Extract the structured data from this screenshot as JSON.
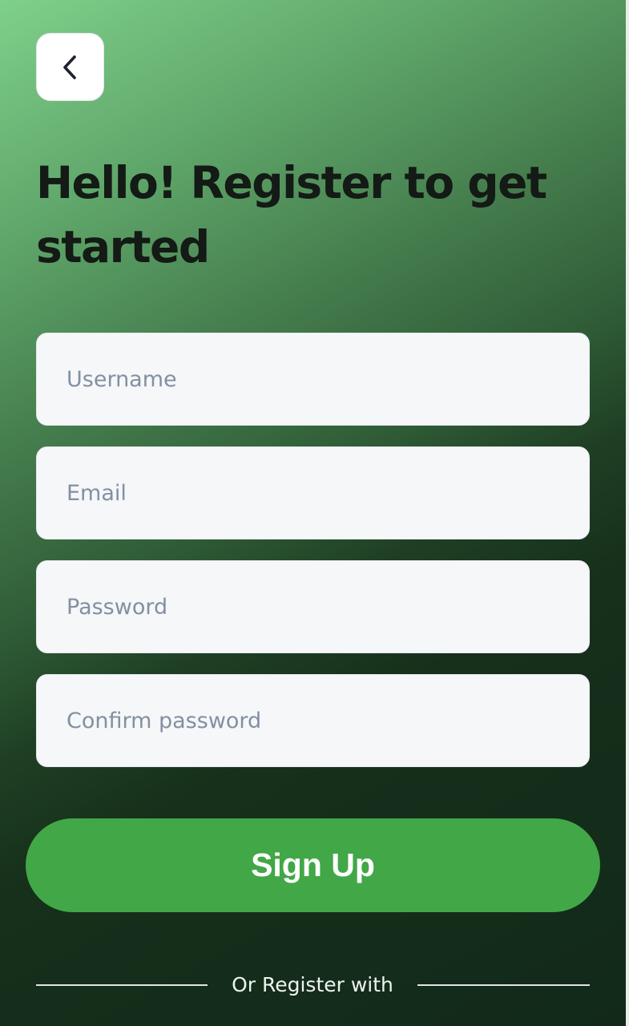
{
  "header": {
    "back_icon": "chevron-left-icon"
  },
  "title": "Hello! Register to get started",
  "form": {
    "username_placeholder": "Username",
    "email_placeholder": "Email",
    "password_placeholder": "Password",
    "confirm_password_placeholder": "Confirm password"
  },
  "signup_label": "Sign Up",
  "divider_text": "Or Register with",
  "colors": {
    "accent": "#42a747",
    "title_text": "#141a15",
    "field_background": "#f5f7f9",
    "placeholder": "#8390a1"
  }
}
